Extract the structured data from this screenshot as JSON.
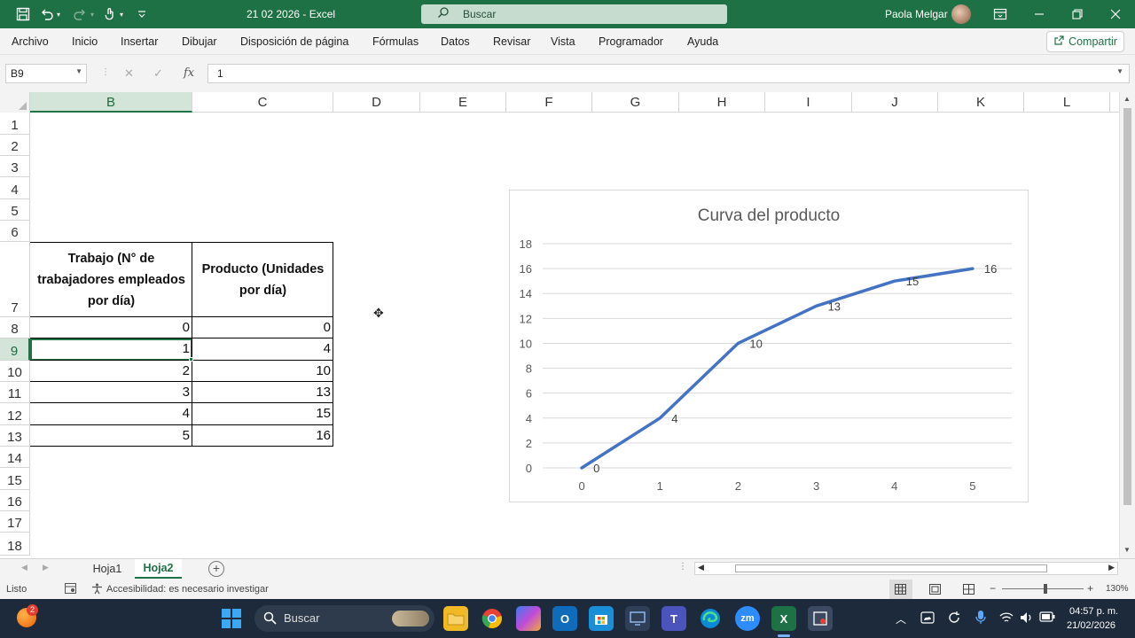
{
  "window": {
    "title": "21 02 2026  -  Excel",
    "search_placeholder": "Buscar",
    "user_name": "Paola Melgar"
  },
  "menu": {
    "items": [
      "Archivo",
      "Inicio",
      "Insertar",
      "Dibujar",
      "Disposición de página",
      "Fórmulas",
      "Datos",
      "Revisar",
      "Vista",
      "Programador",
      "Ayuda"
    ],
    "share_label": "Compartir"
  },
  "formula_bar": {
    "name_box": "B9",
    "fx": "fx",
    "value": "1"
  },
  "grid": {
    "columns": [
      "B",
      "C",
      "D",
      "E",
      "F",
      "G",
      "H",
      "I",
      "J",
      "K",
      "L"
    ],
    "rows": [
      "1",
      "2",
      "3",
      "4",
      "5",
      "6",
      "7",
      "8",
      "9",
      "10",
      "11",
      "12",
      "13",
      "14",
      "15",
      "16",
      "17",
      "18"
    ],
    "selected_cell": "B9"
  },
  "table": {
    "header_b": "Trabajo (N° de trabajadores empleados por día)",
    "header_c": "Producto (Unidades por día)",
    "trabajo": [
      "0",
      "1",
      "2",
      "3",
      "4",
      "5"
    ],
    "producto": [
      "0",
      "4",
      "10",
      "13",
      "15",
      "16"
    ]
  },
  "chart_data": {
    "type": "line",
    "title": "Curva del producto",
    "x": [
      0,
      1,
      2,
      3,
      4,
      5
    ],
    "y": [
      0,
      4,
      10,
      13,
      15,
      16
    ],
    "data_labels": [
      "0",
      "4",
      "10",
      "13",
      "15",
      "16"
    ],
    "x_ticks": [
      "0",
      "1",
      "2",
      "3",
      "4",
      "5"
    ],
    "y_ticks": [
      "0",
      "2",
      "4",
      "6",
      "8",
      "10",
      "12",
      "14",
      "16",
      "18"
    ],
    "ylim": [
      0,
      18
    ],
    "grid": true,
    "legend": "none",
    "line_color": "#4472c4",
    "xlabel": "",
    "ylabel": ""
  },
  "sheets": {
    "tabs": [
      "Hoja1",
      "Hoja2"
    ],
    "active": "Hoja2",
    "add_label": "+"
  },
  "status": {
    "ready": "Listo",
    "accessibility": "Accesibilidad: es necesario investigar",
    "zoom": "130%"
  },
  "taskbar": {
    "search_placeholder": "Buscar",
    "time": "04:57 p. m.",
    "date": "21/02/2026",
    "notification_count": "2",
    "zoom_app_label": "zm"
  },
  "colors": {
    "excel_green": "#1e7145",
    "selection_green": "#217346",
    "series_blue": "#4472c4"
  }
}
